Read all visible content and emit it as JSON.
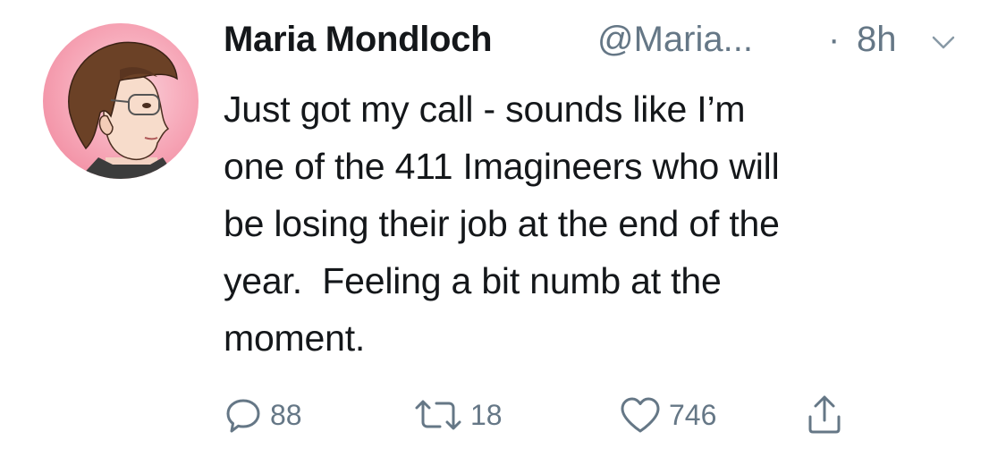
{
  "tweet": {
    "author": {
      "display_name": "Maria Mondloch",
      "handle": "@Maria...",
      "avatar_icon": "cartoon-profile-avatar"
    },
    "separator": "·",
    "time": "8h",
    "text": "Just got my call - sounds like I’m\none of the 411 Imagineers who will\nbe losing their job at the end of the\nyear.  Feeling a bit numb at the\nmoment.",
    "actions": {
      "reply_count": "88",
      "retweet_count": "18",
      "like_count": "746"
    },
    "icons": {
      "reply": "reply-icon",
      "retweet": "retweet-icon",
      "like": "heart-icon",
      "share": "share-icon",
      "menu": "chevron-down-icon"
    },
    "colors": {
      "text_primary": "#14171a",
      "text_secondary": "#657786",
      "avatar_background": "#f6a4b5"
    }
  }
}
